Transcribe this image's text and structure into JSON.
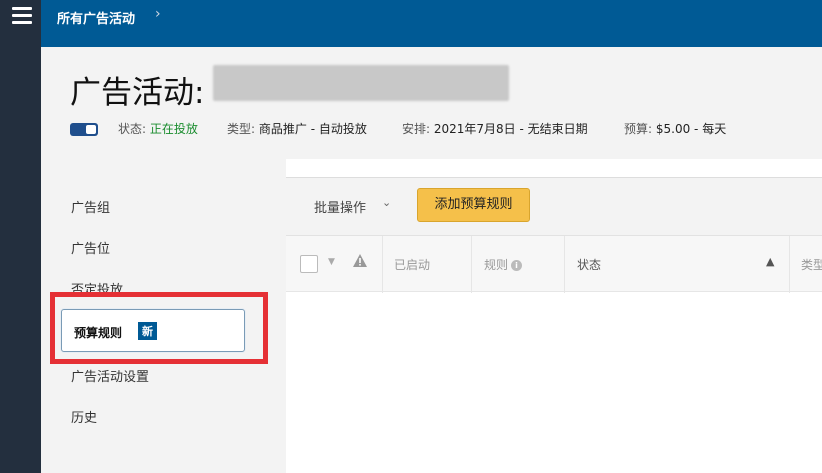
{
  "breadcrumb": {
    "label": "所有广告活动",
    "chevron": "›"
  },
  "header": {
    "title": "广告活动:",
    "status_label": "状态:",
    "status_value": "正在投放",
    "type_label": "类型:",
    "type_value": "商品推广 - 自动投放",
    "schedule_label": "安排:",
    "schedule_value": "2021年7月8日 - 无结束日期",
    "budget_label": "预算:",
    "budget_value": "$5.00 - 每天",
    "campaign_enabled": true
  },
  "sidebar": {
    "items": [
      {
        "label": "广告组"
      },
      {
        "label": "广告位"
      },
      {
        "label": "否定投放"
      },
      {
        "label": "预算规则",
        "badge": "新",
        "active": true
      },
      {
        "label": "广告活动设置"
      },
      {
        "label": "历史"
      }
    ]
  },
  "toolbar": {
    "bulk_label": "批量操作",
    "add_rule_label": "添加预算规则"
  },
  "table": {
    "columns": [
      "已启动",
      "规则",
      "状态",
      "类型"
    ]
  },
  "icons": {
    "menu": "menu-icon",
    "warning": "warning-icon",
    "info": "info-icon",
    "sort": "sort-up-icon"
  },
  "colors": {
    "topbar": "#005a95",
    "rail": "#232f3e",
    "status_green": "#1a8c2e",
    "add_button": "#f5c04a",
    "highlight": "#e53035"
  }
}
